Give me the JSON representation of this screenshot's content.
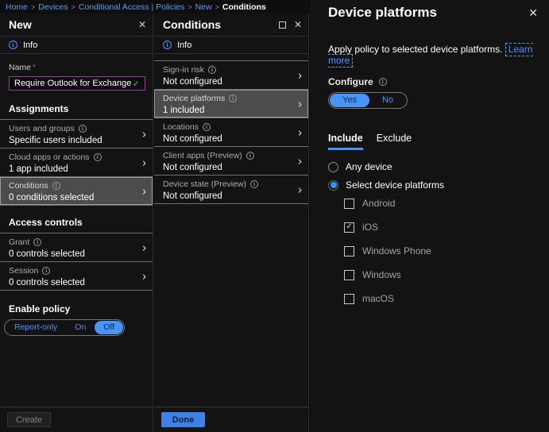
{
  "icons": {
    "close": "✕",
    "chevron": "›",
    "check": "✓",
    "info": "i"
  },
  "colors": {
    "accent_blue": "#4894fe",
    "link_blue": "#5a9df2",
    "valid_green": "#5fba46",
    "input_border_purple": "#8f3f97",
    "highlight_gray": "#4c4c4c",
    "primary_button_bg": "#3f82e7"
  },
  "breadcrumb": {
    "links": [
      "Home",
      "Devices",
      "Conditional Access | Policies",
      "New"
    ],
    "current": "Conditions",
    "separator": ">"
  },
  "panels": {
    "new": {
      "title": "New",
      "info_label": "Info",
      "name_label": "Name",
      "required_marker": "*",
      "name_value": "Require Outlook for Exchange",
      "sections": [
        {
          "heading": "Assignments",
          "items": [
            {
              "label": "Users and groups",
              "value": "Specific users included",
              "highlighted": false
            },
            {
              "label": "Cloud apps or actions",
              "value": "1 app included",
              "highlighted": false
            },
            {
              "label": "Conditions",
              "value": "0 conditions selected",
              "highlighted": true
            }
          ]
        },
        {
          "heading": "Access controls",
          "items": [
            {
              "label": "Grant",
              "value": "0 controls selected",
              "highlighted": false
            },
            {
              "label": "Session",
              "value": "0 controls selected",
              "highlighted": false
            }
          ]
        }
      ],
      "enable_policy": {
        "label": "Enable policy",
        "options": [
          "Report-only",
          "On",
          "Off"
        ],
        "selected": "Off"
      },
      "create_button": "Create"
    },
    "conditions": {
      "title": "Conditions",
      "info_label": "Info",
      "items": [
        {
          "label": "Sign-in risk",
          "value": "Not configured",
          "highlighted": false
        },
        {
          "label": "Device platforms",
          "value": "1 included",
          "highlighted": true
        },
        {
          "label": "Locations",
          "value": "Not configured",
          "highlighted": false
        },
        {
          "label": "Client apps (Preview)",
          "value": "Not configured",
          "highlighted": false
        },
        {
          "label": "Device state (Preview)",
          "value": "Not configured",
          "highlighted": false
        }
      ],
      "done_button": "Done"
    },
    "device_platforms": {
      "title": "Device platforms",
      "description": "Apply policy to selected device platforms.",
      "learn_more": "Learn more",
      "configure_label": "Configure",
      "configure_options": [
        "Yes",
        "No"
      ],
      "configure_selected": "Yes",
      "tabs": [
        "Include",
        "Exclude"
      ],
      "active_tab": "Include",
      "radios": [
        {
          "label": "Any device",
          "selected": false
        },
        {
          "label": "Select device platforms",
          "selected": true
        }
      ],
      "platforms": [
        {
          "label": "Android",
          "checked": false
        },
        {
          "label": "iOS",
          "checked": true
        },
        {
          "label": "Windows Phone",
          "checked": false
        },
        {
          "label": "Windows",
          "checked": false
        },
        {
          "label": "macOS",
          "checked": false
        }
      ]
    }
  }
}
